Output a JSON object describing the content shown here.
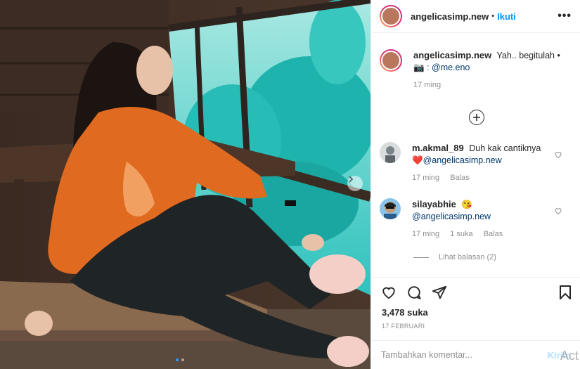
{
  "post": {
    "username": "angelicasimp.new",
    "follow_label": "Ikuti",
    "bullet": "•",
    "more_label": "•••"
  },
  "caption": {
    "username": "angelicasimp.new",
    "text": "Yah.. begitulah •",
    "credit_emoji": "📷",
    "credit_sep": " : ",
    "credit_handle": "@me.eno",
    "time": "17 ming"
  },
  "comments": [
    {
      "username": "m.akmal_89",
      "text": "Duh kak cantiknya",
      "emoji": "❤️",
      "mention": "@angelicasimp.new",
      "time": "17 ming",
      "likes": "",
      "reply_label": "Balas"
    },
    {
      "username": "silayabhie",
      "text": "",
      "emoji": "😘",
      "mention": "@angelicasimp.new",
      "time": "17 ming",
      "likes": "1 suka",
      "reply_label": "Balas"
    }
  ],
  "view_replies": "Lihat balasan (2)",
  "likes_count": "3,478 suka",
  "post_date": "17 FEBRUARI",
  "add_comment": {
    "placeholder": "Tambahkan komentar...",
    "post_label": "Kirim"
  },
  "watermark": "Act",
  "colors": {
    "accent": "#0095f6",
    "teal_bg": "#2ec6c0",
    "hoodie": "#e06a1f"
  },
  "icons": {
    "heart": "heart-icon",
    "comment": "comment-icon",
    "share": "share-icon",
    "save": "bookmark-icon",
    "load_more": "plus-circle-icon",
    "next": "chevron-right-icon"
  }
}
